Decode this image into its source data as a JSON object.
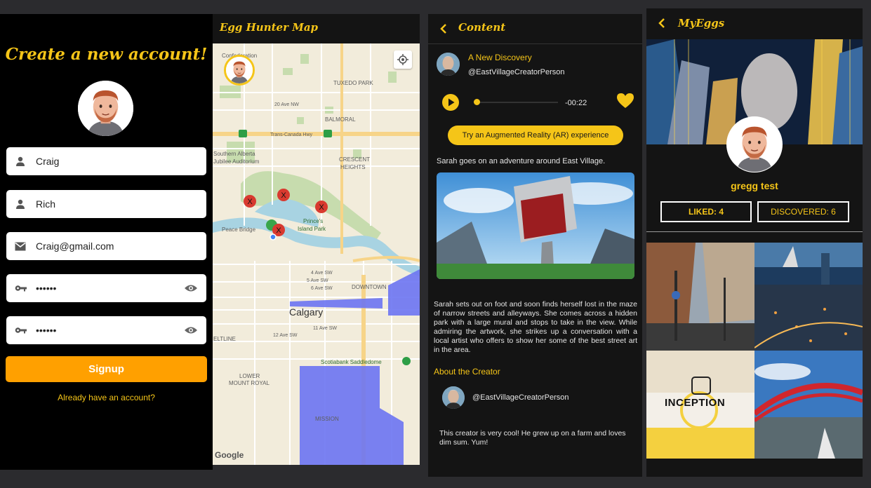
{
  "signup_screen": {
    "title": "Create a new account!",
    "first_name": "Craig",
    "last_name": "Rich",
    "email": "Craig@gmail.com",
    "password": "••••••",
    "confirm_password": "••••••",
    "signup_label": "Signup",
    "login_link": "Already have an account?"
  },
  "map_screen": {
    "title": "Egg Hunter Map",
    "labels": [
      "Confederation",
      "TUXEDO PARK",
      "20 Ave NW",
      "BALMORAL",
      "Trans-Canada Hwy",
      "Southern Alberta",
      "Jubilee Auditorium",
      "CRESCENT",
      "HEIGHTS",
      "Prince's",
      "Island Park",
      "Peace Bridge",
      "DOWNTOWN",
      "Calgary",
      "4 Ave SW",
      "5 Ave SW",
      "6 Ave SW",
      "11 Ave SW",
      "12 Ave SW",
      "ELTLINE",
      "Scotiabank Saddledome",
      "LOWER",
      "MOUNT ROYAL",
      "MISSION"
    ],
    "google": "Google"
  },
  "content_screen": {
    "title": "Content",
    "post_title": "A New Discovery",
    "username": "@EastVillageCreatorPerson",
    "time": "-00:22",
    "ar_label": "Try an Augmented Reality (AR) experience",
    "summary": "Sarah goes on an adventure around East Village.",
    "body": "Sarah sets out on foot and soon finds herself lost in the maze of narrow streets and alleyways. She comes across a hidden park with a large mural and stops to take in the view. While admiring the artwork, she strikes up a conversation with a local artist who offers to show her some of the best street art in the area.",
    "about_heading": "About the Creator",
    "creator_username": "@EastVillageCreatorPerson",
    "bio": "This creator is very cool! He grew up on a farm and loves dim sum. Yum!"
  },
  "myeggs_screen": {
    "title": "MyEggs",
    "user_name": "gregg test",
    "liked": "LIKED: 4",
    "discovered": "DISCOVERED: 6",
    "inception": "INCEPTION"
  },
  "colors": {
    "accent": "#f5c518",
    "signup": "#ffa000",
    "dark": "#141414"
  }
}
